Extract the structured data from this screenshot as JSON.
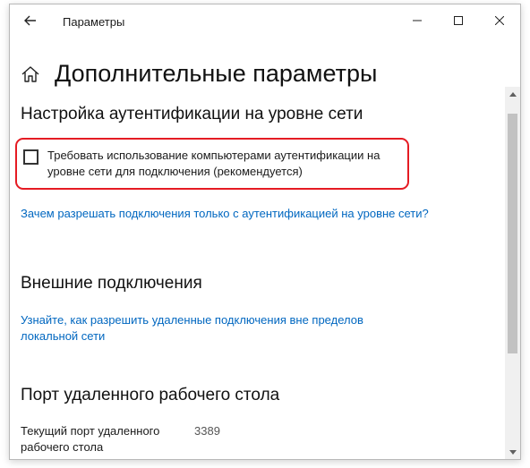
{
  "window": {
    "title": "Параметры",
    "controls": [
      "minimize-icon",
      "maximize-icon",
      "close-icon"
    ]
  },
  "page": {
    "title": "Дополнительные параметры",
    "icon": "home-icon"
  },
  "nla_section": {
    "title": "Настройка аутентификации на уровне сети",
    "checkbox_label": "Требовать использование компьютерами аутентификации на уровне сети для подключения (рекомендуется)",
    "checkbox_checked": false,
    "link": "Зачем разрешать подключения только с аутентификацией на уровне сети?"
  },
  "external_section": {
    "title": "Внешние подключения",
    "link": "Узнайте, как разрешить удаленные подключения вне пределов локальной сети"
  },
  "port_section": {
    "title": "Порт удаленного рабочего стола",
    "label": "Текущий порт удаленного рабочего стола",
    "value": "3389"
  },
  "colors": {
    "link": "#0067c0",
    "highlight": "#e51b23"
  }
}
